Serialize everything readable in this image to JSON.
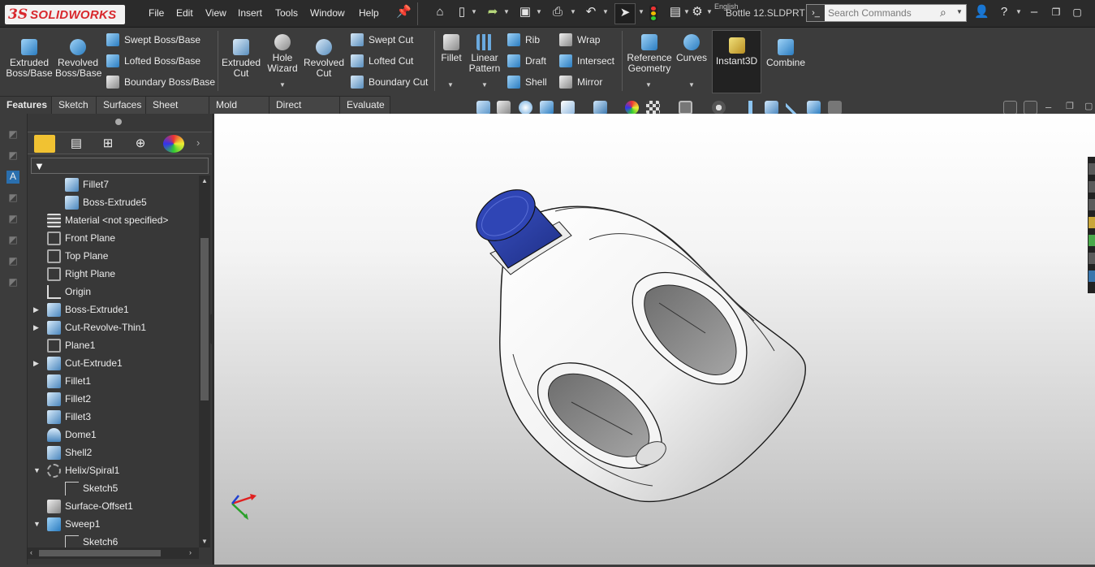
{
  "app": {
    "logo_ds": "3S",
    "logo_text": "SOLIDWORKS",
    "document": "Bottle 12.SLDPRT",
    "language": "English"
  },
  "menu": [
    "File",
    "Edit",
    "View",
    "Insert",
    "Tools",
    "Window",
    "Help"
  ],
  "search": {
    "placeholder": "Search Commands"
  },
  "ribbon": {
    "extruded_boss": "Extruded Boss/Base",
    "revolved_boss": "Revolved Boss/Base",
    "swept_boss": "Swept Boss/Base",
    "lofted_boss": "Lofted Boss/Base",
    "boundary_boss": "Boundary Boss/Base",
    "extruded_cut": "Extruded Cut",
    "hole_wizard": "Hole Wizard",
    "revolved_cut": "Revolved Cut",
    "swept_cut": "Swept Cut",
    "lofted_cut": "Lofted Cut",
    "boundary_cut": "Boundary Cut",
    "fillet": "Fillet",
    "linear_pattern": "Linear Pattern",
    "rib": "Rib",
    "draft": "Draft",
    "shell": "Shell",
    "wrap": "Wrap",
    "intersect": "Intersect",
    "mirror": "Mirror",
    "reference_geometry": "Reference Geometry",
    "curves": "Curves",
    "instant3d": "Instant3D",
    "combine": "Combine"
  },
  "tabs": [
    "Features",
    "Sketch",
    "Surfaces",
    "Sheet Metal",
    "Mold Tools",
    "Direct Editing",
    "Evaluate"
  ],
  "tree": [
    {
      "label": "Fillet7",
      "indent": 1
    },
    {
      "label": "Boss-Extrude5",
      "indent": 1
    },
    {
      "label": "Material <not specified>",
      "indent": 0
    },
    {
      "label": "Front Plane",
      "indent": 0
    },
    {
      "label": "Top Plane",
      "indent": 0
    },
    {
      "label": "Right Plane",
      "indent": 0
    },
    {
      "label": "Origin",
      "indent": 0
    },
    {
      "label": "Boss-Extrude1",
      "indent": 0,
      "expander": "right"
    },
    {
      "label": "Cut-Revolve-Thin1",
      "indent": 0,
      "expander": "right"
    },
    {
      "label": "Plane1",
      "indent": 0
    },
    {
      "label": "Cut-Extrude1",
      "indent": 0,
      "expander": "right"
    },
    {
      "label": "Fillet1",
      "indent": 0
    },
    {
      "label": "Fillet2",
      "indent": 0
    },
    {
      "label": "Fillet3",
      "indent": 0
    },
    {
      "label": "Dome1",
      "indent": 0
    },
    {
      "label": "Shell2",
      "indent": 0
    },
    {
      "label": "Helix/Spiral1",
      "indent": 0,
      "expander": "down"
    },
    {
      "label": "Sketch5",
      "indent": 1
    },
    {
      "label": "Surface-Offset1",
      "indent": 0
    },
    {
      "label": "Sweep1",
      "indent": 0,
      "expander": "down"
    },
    {
      "label": "Sketch6",
      "indent": 1
    }
  ],
  "colors": {
    "cap": "#2b3fa0",
    "body": "#f4f4f4",
    "accent_blue": "#2a7cc0"
  }
}
